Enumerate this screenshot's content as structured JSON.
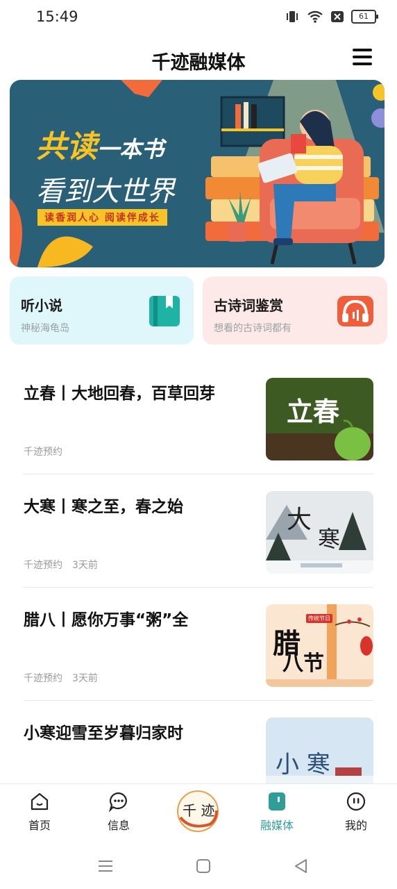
{
  "status": {
    "time": "15:49",
    "battery": "61",
    "icons": [
      "vibrate-icon",
      "wifi-icon",
      "notification-x-icon",
      "battery-icon"
    ]
  },
  "header": {
    "title": "千迹融媒体",
    "menu_icon": "hamburger-menu-icon"
  },
  "banner": {
    "headline_1": "共读",
    "headline_1b": "一本书",
    "headline_2": "看到大世界",
    "tagline": "读香润人心 阅读伴成长"
  },
  "cards": [
    {
      "title": "听小说",
      "subtitle": "神秘海龟岛",
      "icon": "book-icon",
      "color": "#dff6fb"
    },
    {
      "title": "古诗词鉴赏",
      "subtitle": "想看的古诗词都有",
      "icon": "headphones-icon",
      "color": "#fde9e7"
    }
  ],
  "feed": [
    {
      "title": "立春丨大地回春，百草回芽",
      "source": "千迹预约",
      "time": "",
      "thumb_text": "立春"
    },
    {
      "title": "大寒丨寒之至，春之始",
      "source": "千迹预约",
      "time": "3天前",
      "thumb_text_1": "大",
      "thumb_text_2": "寒"
    },
    {
      "title": "腊八丨愿你万事“粥”全",
      "source": "千迹预约",
      "time": "3天前",
      "thumb_text_1": "腊",
      "thumb_text_2": "八节",
      "thumb_badge": "传统节日"
    },
    {
      "title": "小寒迎雪至岁暮归家时",
      "source": "",
      "time": "",
      "thumb_text": "小 寒"
    }
  ],
  "tabs": [
    {
      "label": "首页",
      "icon": "home-icon",
      "active": false
    },
    {
      "label": "信息",
      "icon": "chat-bubble-icon",
      "active": false
    },
    {
      "label": "",
      "icon": "center-logo-icon",
      "logo_text": "千 迹",
      "active": false
    },
    {
      "label": "融媒体",
      "icon": "media-icon",
      "active": true
    },
    {
      "label": "我的",
      "icon": "profile-icon",
      "active": false
    }
  ],
  "colors": {
    "accent": "#2e9e96",
    "banner_bg": "#2a5f78",
    "banner_accent": "#f7c427"
  },
  "system_nav": [
    "recents-icon",
    "home-square-icon",
    "back-triangle-icon"
  ]
}
